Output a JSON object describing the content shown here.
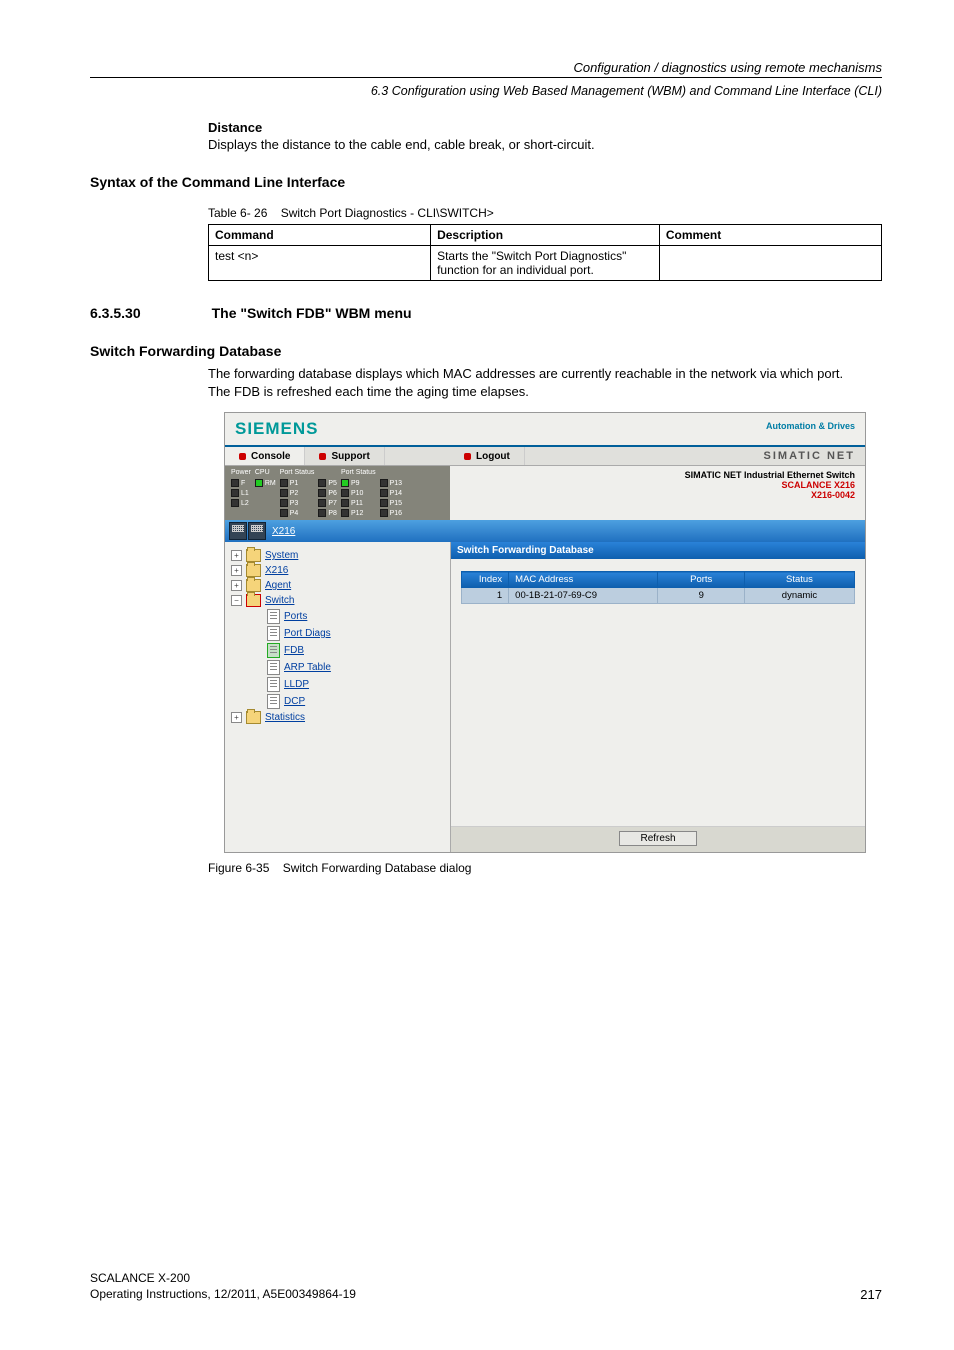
{
  "header": {
    "title_right": "Configuration / diagnostics using remote mechanisms",
    "sub_right": "6.3 Configuration using Web Based Management (WBM) and Command Line Interface (CLI)"
  },
  "distance": {
    "title": "Distance",
    "text": "Displays the distance to the cable end, cable break, or short-circuit."
  },
  "syntax": {
    "title": "Syntax of the Command Line Interface",
    "table_caption_prefix": "Table 6- 26",
    "table_caption_text": "Switch Port Diagnostics - CLI\\SWITCH>",
    "cols": {
      "c1": "Command",
      "c2": "Description",
      "c3": "Comment"
    },
    "row": {
      "cmd": "test <n>",
      "desc": "Starts the \"Switch Port Diagnostics\" function for an individual port.",
      "comment": ""
    }
  },
  "menu": {
    "num": "6.3.5.30",
    "title": "The \"Switch FDB\" WBM menu"
  },
  "sfd": {
    "title": "Switch Forwarding Database",
    "p1": "The forwarding database displays which MAC addresses are currently reachable in the network via which port.",
    "p2": "The FDB is refreshed each time the aging time elapses."
  },
  "screenshot": {
    "siemens": "SIEMENS",
    "brand": "Automation & Drives",
    "menu": {
      "console": "Console",
      "support": "Support",
      "logout": "Logout",
      "simatic_net": "SIMATIC NET"
    },
    "status_left": {
      "groups": [
        {
          "label": "Power",
          "lines": [
            {
              "t": "F",
              "g": false
            },
            {
              "t": "L1",
              "g": false
            },
            {
              "t": "L2",
              "g": false
            }
          ]
        },
        {
          "label": "CPU",
          "lines": [
            {
              "t": "RM",
              "g": true
            }
          ]
        },
        {
          "label": "Port Status",
          "lines": [
            {
              "t": "P1",
              "g": false
            },
            {
              "t": "P2",
              "g": false
            },
            {
              "t": "P3",
              "g": false
            },
            {
              "t": "P4",
              "g": false
            }
          ]
        },
        {
          "label": "",
          "lines": [
            {
              "t": "P5",
              "g": false
            },
            {
              "t": "P6",
              "g": false
            },
            {
              "t": "P7",
              "g": false
            },
            {
              "t": "P8",
              "g": false
            }
          ]
        },
        {
          "label": "Port Status",
          "lines": [
            {
              "t": "P9",
              "g": true
            },
            {
              "t": "P10",
              "g": false
            },
            {
              "t": "P11",
              "g": false
            },
            {
              "t": "P12",
              "g": false
            }
          ]
        },
        {
          "label": "",
          "lines": [
            {
              "t": "P13",
              "g": false
            },
            {
              "t": "P14",
              "g": false
            },
            {
              "t": "P15",
              "g": false
            },
            {
              "t": "P16",
              "g": false
            }
          ]
        }
      ]
    },
    "status_right": {
      "l1": "SIMATIC NET Industrial Ethernet Switch",
      "l2a": "SCALANCE X216",
      "l2b": "X216-0042"
    },
    "device_label": "X216",
    "tree": {
      "system": "System",
      "x216": "X216",
      "agent": "Agent",
      "switch": "Switch",
      "ports": "Ports",
      "portdiags": "Port Diags",
      "fdb": "FDB",
      "arp": "ARP Table",
      "lldp": "LLDP",
      "dcp": "DCP",
      "stats": "Statistics"
    },
    "banner": "Switch Forwarding Database",
    "table": {
      "h_index": "Index",
      "h_mac": "MAC Address",
      "h_ports": "Ports",
      "h_status": "Status",
      "row": {
        "index": "1",
        "mac": "00-1B-21-07-69-C9",
        "ports": "9",
        "status": "dynamic"
      }
    },
    "refresh": "Refresh"
  },
  "fig_caption_prefix": "Figure 6-35",
  "fig_caption_text": "Switch Forwarding Database dialog",
  "footer": {
    "l1": "SCALANCE X-200",
    "l2": "Operating Instructions, 12/2011, A5E00349864-19",
    "page": "217"
  }
}
